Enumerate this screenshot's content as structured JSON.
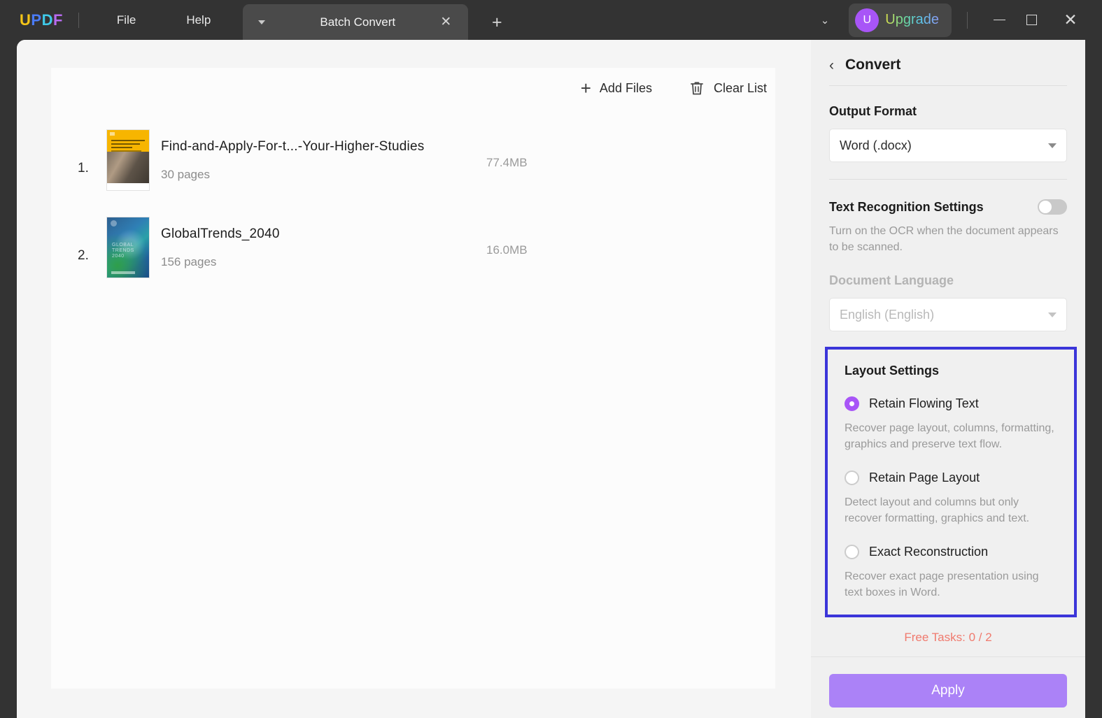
{
  "titlebar": {
    "logo_letters": [
      "U",
      "P",
      "D",
      "F"
    ],
    "menus": [
      {
        "name": "menu-file",
        "label": "File"
      },
      {
        "name": "menu-help",
        "label": "Help"
      }
    ],
    "tab": {
      "title": "Batch Convert",
      "close_glyph": "✕",
      "caret_icon": "chevron-down-icon"
    },
    "new_tab_glyph": "+",
    "chevron_down_glyph": "⌄",
    "upgrade": {
      "avatar_letter": "U",
      "label": "Upgrade"
    },
    "window_controls": {
      "minimize": "minimize-icon",
      "maximize": "maximize-icon",
      "close_glyph": "✕"
    }
  },
  "main": {
    "toolbar": {
      "add_files_label": "Add Files",
      "add_files_glyph": "+",
      "clear_list_label": "Clear List"
    },
    "files": [
      {
        "index": "1.",
        "name": "Find-and-Apply-For-t...-Your-Higher-Studies",
        "pages": "30 pages",
        "size": "77.4MB"
      },
      {
        "index": "2.",
        "name": "GlobalTrends_2040",
        "pages": "156 pages",
        "size": "16.0MB",
        "thumb_title": "GLOBAL TRENDS 2040"
      }
    ]
  },
  "panel": {
    "back_glyph": "‹",
    "title": "Convert",
    "output_format_label": "Output Format",
    "output_format_value": "Word (.docx)",
    "text_recognition_label": "Text Recognition Settings",
    "text_recognition_enabled": false,
    "ocr_hint": "Turn on the OCR when the document appears to be scanned.",
    "document_language_label": "Document Language",
    "document_language_value": "English (English)",
    "layout_settings": {
      "title": "Layout Settings",
      "highlight_color": "#3B35D9",
      "selected_color": "#A855F7",
      "options": [
        {
          "label": "Retain Flowing Text",
          "selected": true,
          "description": "Recover page layout, columns, formatting, graphics and preserve text flow."
        },
        {
          "label": "Retain Page Layout",
          "selected": false,
          "description": "Detect layout and columns but only recover formatting, graphics and text."
        },
        {
          "label": "Exact Reconstruction",
          "selected": false,
          "description": "Recover exact page presentation using text boxes in Word."
        }
      ]
    },
    "free_tasks": "Free Tasks: 0 / 2",
    "free_tasks_color": "#F07A6E",
    "apply_label": "Apply",
    "apply_color": "#AB82F7"
  }
}
